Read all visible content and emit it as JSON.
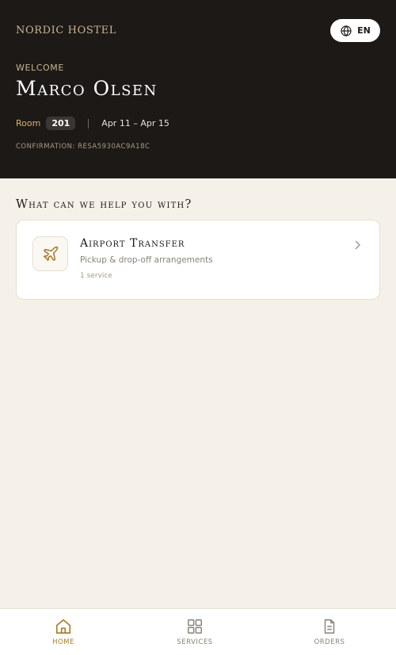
{
  "header": {
    "brand": "NORDIC HOSTEL",
    "language": {
      "label": "EN",
      "icon": "globe-icon"
    },
    "welcome_label": "WELCOME",
    "guest_name": "Marco Olsen",
    "room_label": "Room",
    "room_number": "201",
    "dates": "Apr 11 – Apr 15",
    "confirmation": "CONFIRMATION: RESA5930AC9A18C"
  },
  "main": {
    "section_title": "What can we help you with?",
    "services": [
      {
        "icon": "airplane-icon",
        "name": "Airport Transfer",
        "description": "Pickup & drop-off arrangements",
        "count": "1 service"
      }
    ]
  },
  "nav": {
    "items": [
      {
        "label": "HOME",
        "icon": "home-icon",
        "active": true
      },
      {
        "label": "SERVICES",
        "icon": "grid-icon",
        "active": false
      },
      {
        "label": "ORDERS",
        "icon": "document-icon",
        "active": false
      }
    ]
  },
  "colors": {
    "header_bg": "#1c1917",
    "accent": "#a67c2e",
    "page_bg": "#f5f1e8"
  }
}
